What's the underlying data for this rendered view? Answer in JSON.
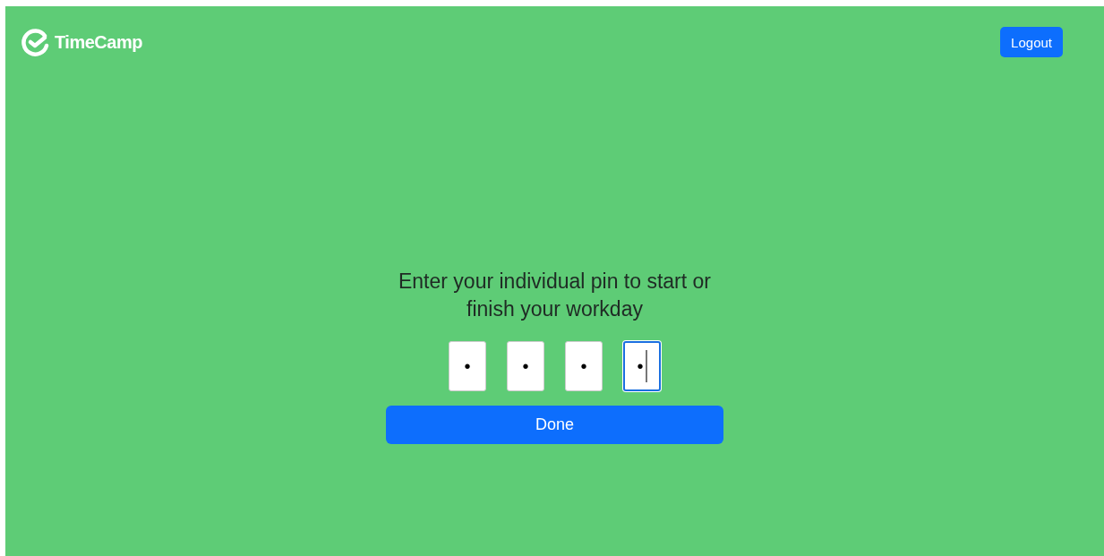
{
  "brand": {
    "name": "TimeCamp"
  },
  "logout_button": "Logout",
  "prompt": "Enter your individual pin to start or finish your workday",
  "pin_fields": [
    {
      "value": "•",
      "focused": false
    },
    {
      "value": "•",
      "focused": false
    },
    {
      "value": "•",
      "focused": false
    },
    {
      "value": "•",
      "focused": true
    }
  ],
  "done_button": "Done"
}
